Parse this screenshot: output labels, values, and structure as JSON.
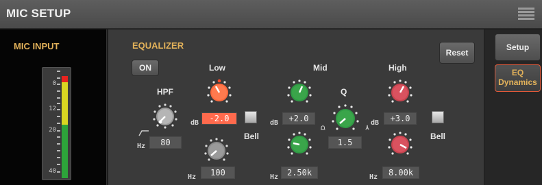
{
  "header": {
    "title": "MIC SETUP",
    "menu_icon": "menu-icon"
  },
  "mic_input": {
    "title": "MIC INPUT",
    "meter_scale": [
      "0",
      "12",
      "20",
      "40"
    ],
    "colors": {
      "red": "#e8231f",
      "yellow": "#d9d622",
      "green": "#2da43a"
    }
  },
  "equalizer": {
    "title": "EQUALIZER",
    "on_label": "ON",
    "reset_label": "Reset",
    "hpf": {
      "label": "HPF",
      "unit": "Hz",
      "value": "80"
    },
    "low": {
      "label": "Low",
      "gain_unit": "dB",
      "gain": "-2.0",
      "freq_unit": "Hz",
      "freq": "100",
      "shape": "Bell"
    },
    "mid": {
      "label": "Mid",
      "gain_unit": "dB",
      "gain": "+2.0",
      "freq_unit": "Hz",
      "freq": "2.50k",
      "q_label": "Q",
      "q": "1.5"
    },
    "high": {
      "label": "High",
      "gain_unit": "dB",
      "gain": "+3.0",
      "freq_unit": "Hz",
      "freq": "8.00k",
      "shape": "Bell"
    },
    "knob_colors": {
      "low": "#ff6a3d",
      "mid": "#3aa54a",
      "high": "#d9525f",
      "gray": "#8a8a8a"
    }
  },
  "side_tabs": {
    "setup": "Setup",
    "eq_dynamics_line1": "EQ",
    "eq_dynamics_line2": "Dynamics"
  }
}
